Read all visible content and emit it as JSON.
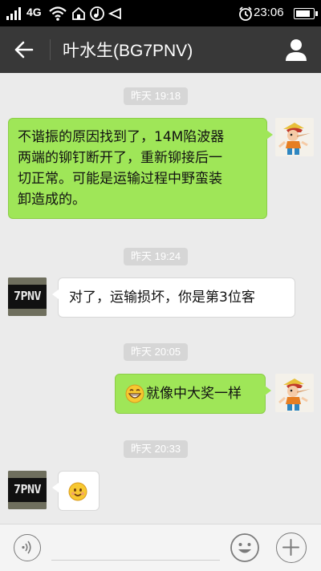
{
  "status_bar": {
    "network": "4G",
    "time": "23:06",
    "battery_level": 0.9,
    "icons": [
      "signal-icon",
      "wifi-icon",
      "home-icon",
      "music-icon",
      "send-icon",
      "alarm-icon",
      "battery-icon"
    ]
  },
  "header": {
    "title": "叶水生(BG7PNV)",
    "icons": [
      "back-arrow-icon",
      "person-icon"
    ]
  },
  "messages": [
    {
      "timestamp": "昨天 19:18",
      "sender": "me",
      "text": [
        "不谐振的原因找到了，14M陷波器",
        "两端的铆钉断开了，重新铆接后一",
        "切正常。可能是运输过程中野蛮装",
        "卸造成的。"
      ]
    },
    {
      "timestamp": "昨天 19:24",
      "sender": "them",
      "avatar_text": "7PNV",
      "text": [
        "对了，运输损坏，你是第3位客"
      ]
    },
    {
      "timestamp": "昨天 20:05",
      "sender": "me",
      "emoji": "grin-emoji",
      "text": [
        "就像中大奖一样"
      ]
    },
    {
      "timestamp": "昨天 20:33",
      "sender": "them",
      "avatar_text": "7PNV",
      "emoji": "smile-emoji",
      "text": [
        ""
      ]
    }
  ],
  "input_bar": {
    "icons": [
      "voice-icon",
      "emoji-icon",
      "plus-icon"
    ]
  },
  "colors": {
    "outgoing_bubble": "#9fe658",
    "incoming_bubble": "#ffffff",
    "title_bar": "#383838",
    "chat_background": "#ebebeb",
    "timestamp_pill": "#d6d6d6"
  }
}
